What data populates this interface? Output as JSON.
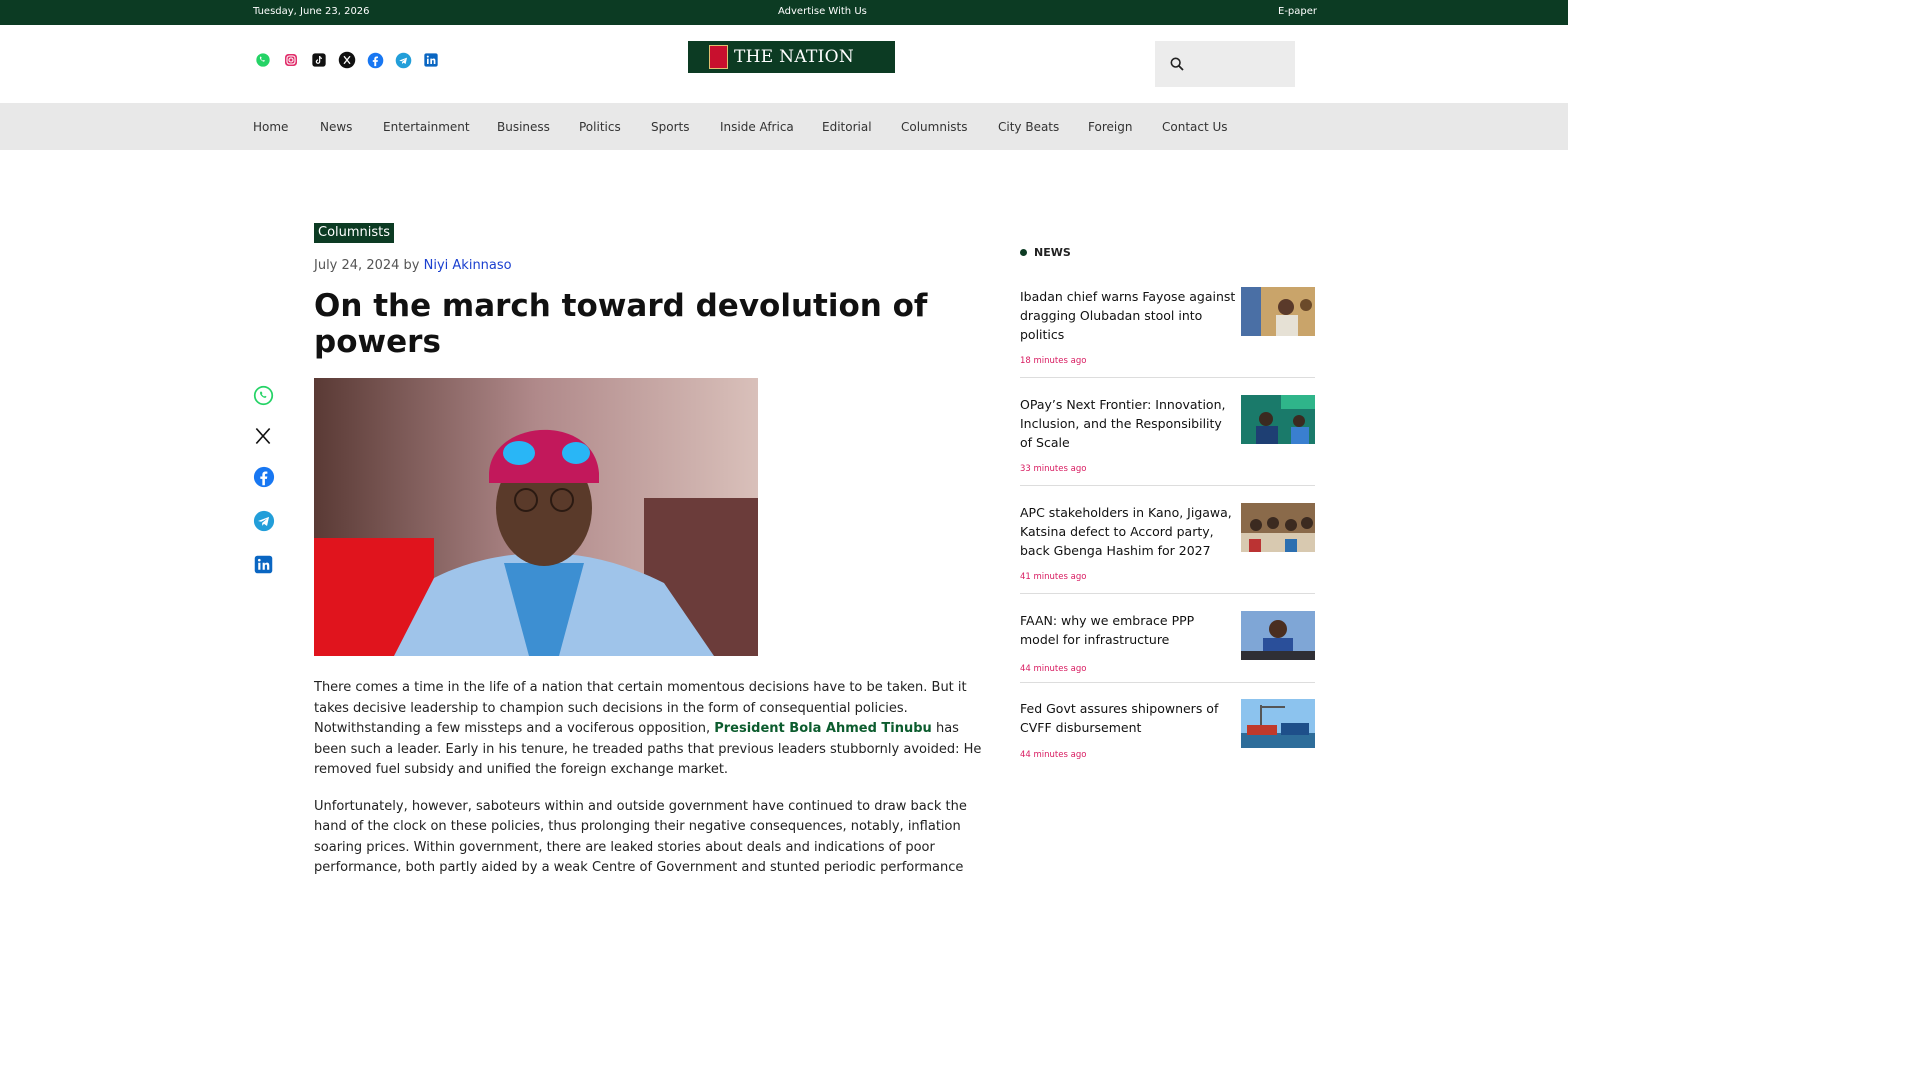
{
  "topbar": {
    "date": "Tuesday, June 23, 2026",
    "advertise": "Advertise With Us",
    "epaper": "E-paper"
  },
  "brand": {
    "name": "THE NATION",
    "color_primary": "#0c3b23",
    "accent": "#d81b60"
  },
  "header": {
    "social_icons": [
      "whatsapp-icon",
      "instagram-icon",
      "tiktok-icon",
      "x-icon",
      "facebook-icon",
      "telegram-icon",
      "linkedin-icon"
    ]
  },
  "nav": {
    "items": [
      "Home",
      "News",
      "Entertainment",
      "Business",
      "Politics",
      "Sports",
      "Inside Africa",
      "Editorial",
      "Columnists",
      "City Beats",
      "Foreign",
      "Contact Us"
    ]
  },
  "article": {
    "category": "Columnists",
    "date": "July 24, 2024",
    "by": "by",
    "author": "Niyi Akinnaso",
    "title": "On the march toward devolution of powers",
    "p1_before": "There comes a time in the life of a nation that certain momentous decisions have to be taken. But it takes decisive leadership to champion such decisions in the form of consequential policies. Notwithstanding a few missteps and a vociferous opposition,",
    "p1_link": "President Bola Ahmed Tinubu",
    "p1_after": "has been such a leader. Early in his tenure, he treaded paths that previous leaders stubbornly avoided: He removed fuel subsidy and unified the foreign exchange market.",
    "p2": "Unfortunately, however, saboteurs within and outside government have continued to draw back the hand of the clock on these policies, thus prolonging their negative consequences, notably, inflation soaring prices. Within government, there are leaked stories about deals and indications of poor performance, both partly aided by a weak Centre of Government and stunted periodic performance"
  },
  "share_icons": [
    "whatsapp-icon",
    "x-icon",
    "facebook-icon",
    "telegram-icon",
    "linkedin-icon"
  ],
  "sidebar": {
    "heading": "NEWS",
    "items": [
      {
        "headline": "Ibadan chief warns Fayose against dragging Olubadan stool into politics",
        "time": "18 minutes ago"
      },
      {
        "headline": "OPay’s Next Frontier: Innovation, Inclusion, and the Responsibility of Scale",
        "time": "33 minutes ago"
      },
      {
        "headline": "APC stakeholders in Kano, Jigawa, Katsina defect to Accord party, back Gbenga Hashim for 2027",
        "time": "41 minutes ago"
      },
      {
        "headline": "FAAN: why we embrace PPP model for infrastructure",
        "time": "44 minutes ago"
      },
      {
        "headline": "Fed Govt assures shipowners of CVFF disbursement",
        "time": "44 minutes ago"
      }
    ]
  }
}
